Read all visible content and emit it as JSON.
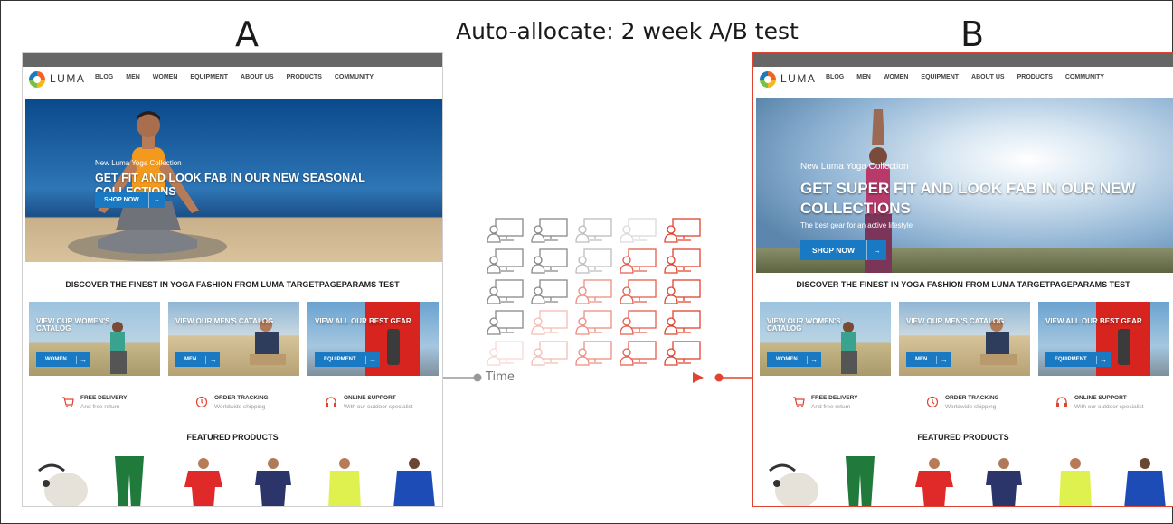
{
  "diagram": {
    "title": "Auto-allocate: 2 week A/B test",
    "label_a": "A",
    "label_b": "B",
    "time_label": "Time",
    "colors": {
      "variant_b": "#e0432f",
      "variant_a": "#888888",
      "accent_blue": "#1979c3"
    }
  },
  "site": {
    "logo": "LUMA",
    "nav": [
      "BLOG",
      "MEN",
      "WOMEN",
      "EQUIPMENT",
      "ABOUT US",
      "PRODUCTS",
      "COMMUNITY"
    ],
    "discover": "DISCOVER THE FINEST IN YOGA FASHION FROM LUMA TARGETPAGEPARAMS TEST",
    "categories": [
      {
        "title": "VIEW OUR WOMEN'S CATALOG",
        "button": "WOMEN"
      },
      {
        "title": "VIEW OUR MEN'S CATALOG",
        "button": "MEN"
      },
      {
        "title": "VIEW ALL OUR BEST GEAR",
        "button": "EQUIPMENT"
      }
    ],
    "features": [
      {
        "title": "FREE DELIVERY",
        "sub": "And free return",
        "icon": "cart-icon"
      },
      {
        "title": "ORDER TRACKING",
        "sub": "Worldwide shipping",
        "icon": "tracking-icon"
      },
      {
        "title": "ONLINE SUPPORT",
        "sub": "With our outdoor specialist",
        "icon": "headset-icon"
      }
    ],
    "featured": "FEATURED PRODUCTS"
  },
  "hero_a": {
    "sub": "New Luma Yoga Collection",
    "headline": "GET FIT AND LOOK FAB IN OUR NEW SEASONAL COLLECTIONS",
    "button": "SHOP NOW"
  },
  "hero_b": {
    "sub": "New Luma Yoga Collection",
    "headline_line1": "GET SUPER FIT AND LOOK FAB IN OUR NEW",
    "headline_line2": "COLLECTIONS",
    "tagline": "The best gear for an active lifestyle",
    "button": "SHOP NOW"
  },
  "visitor_grid": {
    "rows": 5,
    "cols": 5,
    "colors": [
      "#888888",
      "#e0432f"
    ]
  }
}
